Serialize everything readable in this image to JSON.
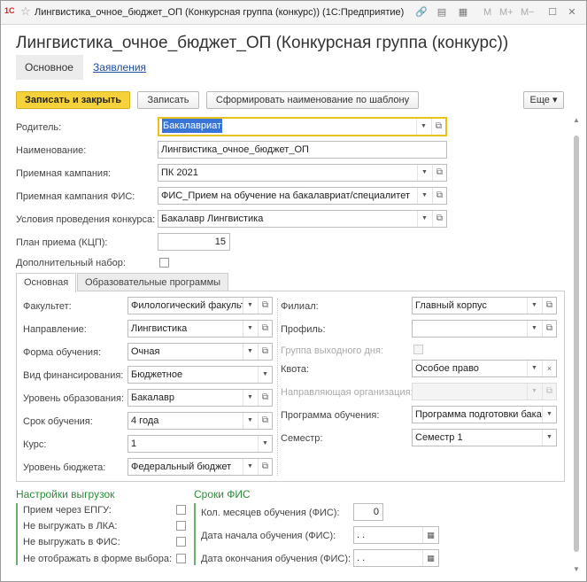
{
  "titlebar": {
    "title": "Лингвистика_очное_бюджет_ОП (Конкурсная группа (конкурс))  (1С:Предприятие)",
    "logo": "1С",
    "m_label": "M",
    "mplus_label": "M+",
    "mminus_label": "M−"
  },
  "header": {
    "title": "Лингвистика_очное_бюджет_ОП (Конкурсная группа (конкурс))",
    "tab_main": "Основное",
    "tab_link": "Заявления"
  },
  "toolbar": {
    "save_close": "Записать и закрыть",
    "save": "Записать",
    "generate_name": "Сформировать наименование по шаблону",
    "more": "Еще"
  },
  "fields": {
    "parent_label": "Родитель:",
    "parent_value": "Бакалавриат",
    "name_label": "Наименование:",
    "name_value": "Лингвистика_очное_бюджет_ОП",
    "campaign_label": "Приемная кампания:",
    "campaign_value": "ПК 2021",
    "fis_campaign_label": "Приемная кампания ФИС:",
    "fis_campaign_value": "ФИС_Прием на обучение на бакалавриат/специалитет",
    "conditions_label": "Условия проведения конкурса:",
    "conditions_value": "Бакалавр Лингвистика",
    "plan_label": "План приема (КЦП):",
    "plan_value": "15",
    "extra_label": "Дополнительный набор:"
  },
  "inner_tabs": {
    "tab_main": "Основная",
    "tab_programs": "Образовательные программы"
  },
  "left_col": {
    "faculty_label": "Факультет:",
    "faculty_value": "Филологический факульт",
    "direction_label": "Направление:",
    "direction_value": "Лингвистика",
    "form_label": "Форма обучения:",
    "form_value": "Очная",
    "financing_label": "Вид финансирования:",
    "financing_value": "Бюджетное",
    "level_label": "Уровень образования:",
    "level_value": "Бакалавр",
    "term_label": "Срок обучения:",
    "term_value": "4 года",
    "course_label": "Курс:",
    "course_value": "1",
    "budget_label": "Уровень бюджета:",
    "budget_value": "Федеральный бюджет"
  },
  "right_col": {
    "branch_label": "Филиал:",
    "branch_value": "Главный корпус",
    "profile_label": "Профиль:",
    "profile_value": "",
    "weekend_label": "Группа выходного дня:",
    "quota_label": "Квота:",
    "quota_value": "Особое право",
    "org_label": "Направляющая организация:",
    "org_value": "",
    "program_label": "Программа обучения:",
    "program_value": "Программа подготовки бака",
    "semester_label": "Семестр:",
    "semester_value": "Семестр 1"
  },
  "export_settings": {
    "title": "Настройки выгрузок",
    "epgu": "Прием через ЕПГУ:",
    "no_lka": "Не выгружать в ЛКА:",
    "no_fis": "Не выгружать в ФИС:",
    "no_show": "Не отображать в форме выбора:"
  },
  "fis_terms": {
    "title": "Сроки ФИС",
    "months_label": "Кол. месяцев обучения (ФИС):",
    "months_value": "0",
    "start_label": "Дата начала обучения (ФИС):",
    "start_value": " .  .",
    "end_label": "Дата окончания обучения (ФИС):",
    "end_value": " .  ."
  },
  "colors": {
    "primary_button": "#f6d23a",
    "group_title": "#2e8b3a",
    "link": "#1c4ca3",
    "focus_border": "#e8c21e"
  }
}
